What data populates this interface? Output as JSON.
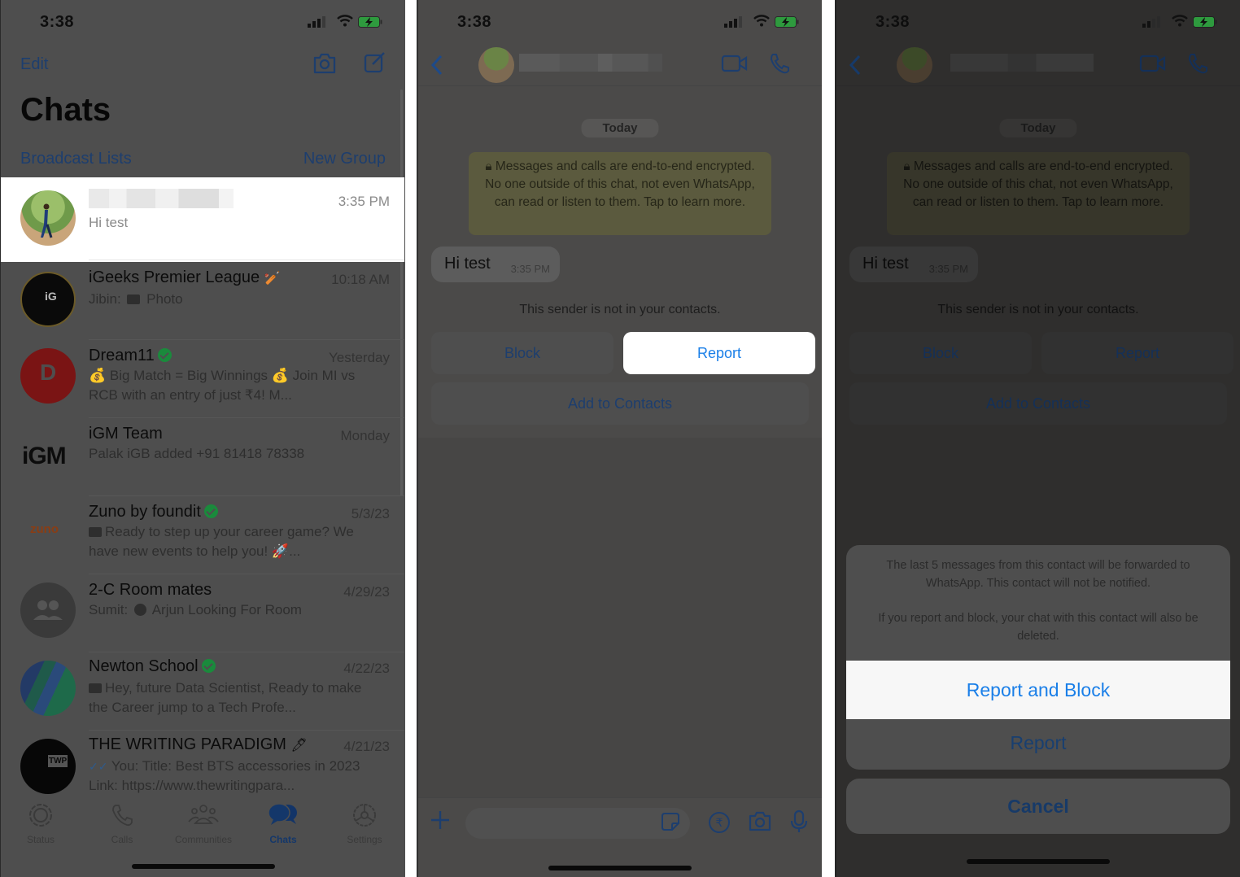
{
  "status_bar": {
    "time": "3:38"
  },
  "panel1": {
    "header": {
      "edit_label": "Edit",
      "camera_icon": "camera-icon",
      "compose_icon": "compose-icon",
      "title": "Chats",
      "broadcast_label": "Broadcast Lists",
      "new_group_label": "New Group"
    },
    "chats": [
      {
        "name": "",
        "name_blurred": true,
        "time": "3:35 PM",
        "preview": "Hi test",
        "selected": true
      },
      {
        "name": "iGeeks Premier League",
        "name_suffix": "🏏",
        "time": "10:18 AM",
        "preview_prefix": "Jibin:",
        "preview_icon": "camera-icon",
        "preview": "Photo"
      },
      {
        "name": "Dream11",
        "verified": true,
        "time": "Yesterday",
        "preview": "💰 Big Match = Big Winnings 💰 Join MI vs RCB with an entry of just ₹4!  M..."
      },
      {
        "name": "iGM Team",
        "time": "Monday",
        "preview": "Palak iGB added +91 81418 78338"
      },
      {
        "name": "Zuno by foundit",
        "verified": true,
        "time": "5/3/23",
        "preview_icon": "camera-icon",
        "preview": "Ready to step up your career game? We have new events to help you! 🚀..."
      },
      {
        "name": "2-C Room mates",
        "time": "4/29/23",
        "preview_prefix": "Sumit:",
        "preview_icon": "contact-icon",
        "preview": "Arjun Looking For Room"
      },
      {
        "name": "Newton School",
        "verified": true,
        "time": "4/22/23",
        "preview_icon": "camera-icon",
        "preview": "Hey, future Data Scientist, Ready to make the Career jump to a Tech Profe..."
      },
      {
        "name": "THE WRITING PARADIGM",
        "name_suffix": "🖊",
        "time": "4/21/23",
        "preview_icon": "double-check-icon",
        "preview": "You: Title: Best BTS accessories in 2023 Link: https://www.thewritingpara..."
      }
    ],
    "tabs": [
      {
        "label": "Status",
        "icon": "status-icon"
      },
      {
        "label": "Calls",
        "icon": "phone-icon"
      },
      {
        "label": "Communities",
        "icon": "communities-icon"
      },
      {
        "label": "Chats",
        "icon": "chats-icon",
        "active": true
      },
      {
        "label": "Settings",
        "icon": "settings-icon"
      }
    ],
    "avatar_labels": {
      "igeeks": "iG",
      "dream11": "D",
      "igm": "iGM",
      "zuno": "zuno",
      "twp": "TWP"
    }
  },
  "chat_view": {
    "date_label": "Today",
    "encryption_notice": "Messages and calls are end-to-end encrypted. No one outside of this chat, not even WhatsApp, can read or listen to them. Tap to learn more.",
    "message": {
      "text": "Hi test",
      "time": "3:35 PM"
    },
    "not_in_contacts": "This sender is not in your contacts.",
    "block_label": "Block",
    "report_label": "Report",
    "add_contacts_label": "Add to Contacts"
  },
  "panel2": {
    "highlighted_button": "Report"
  },
  "panel3": {
    "sheet": {
      "message_1": "The last 5 messages from this contact will be forwarded to WhatsApp. This contact will not be notified.",
      "message_2": "If you report and block, your chat with this contact will also be deleted.",
      "report_and_block_label": "Report and Block",
      "report_label": "Report",
      "cancel_label": "Cancel"
    }
  },
  "colors": {
    "accent_blue": "#1a7fe8",
    "dimmed_blue": "#1d3e6e",
    "verified_green": "#1a8a3c",
    "battery_green": "#2e9a3e"
  }
}
